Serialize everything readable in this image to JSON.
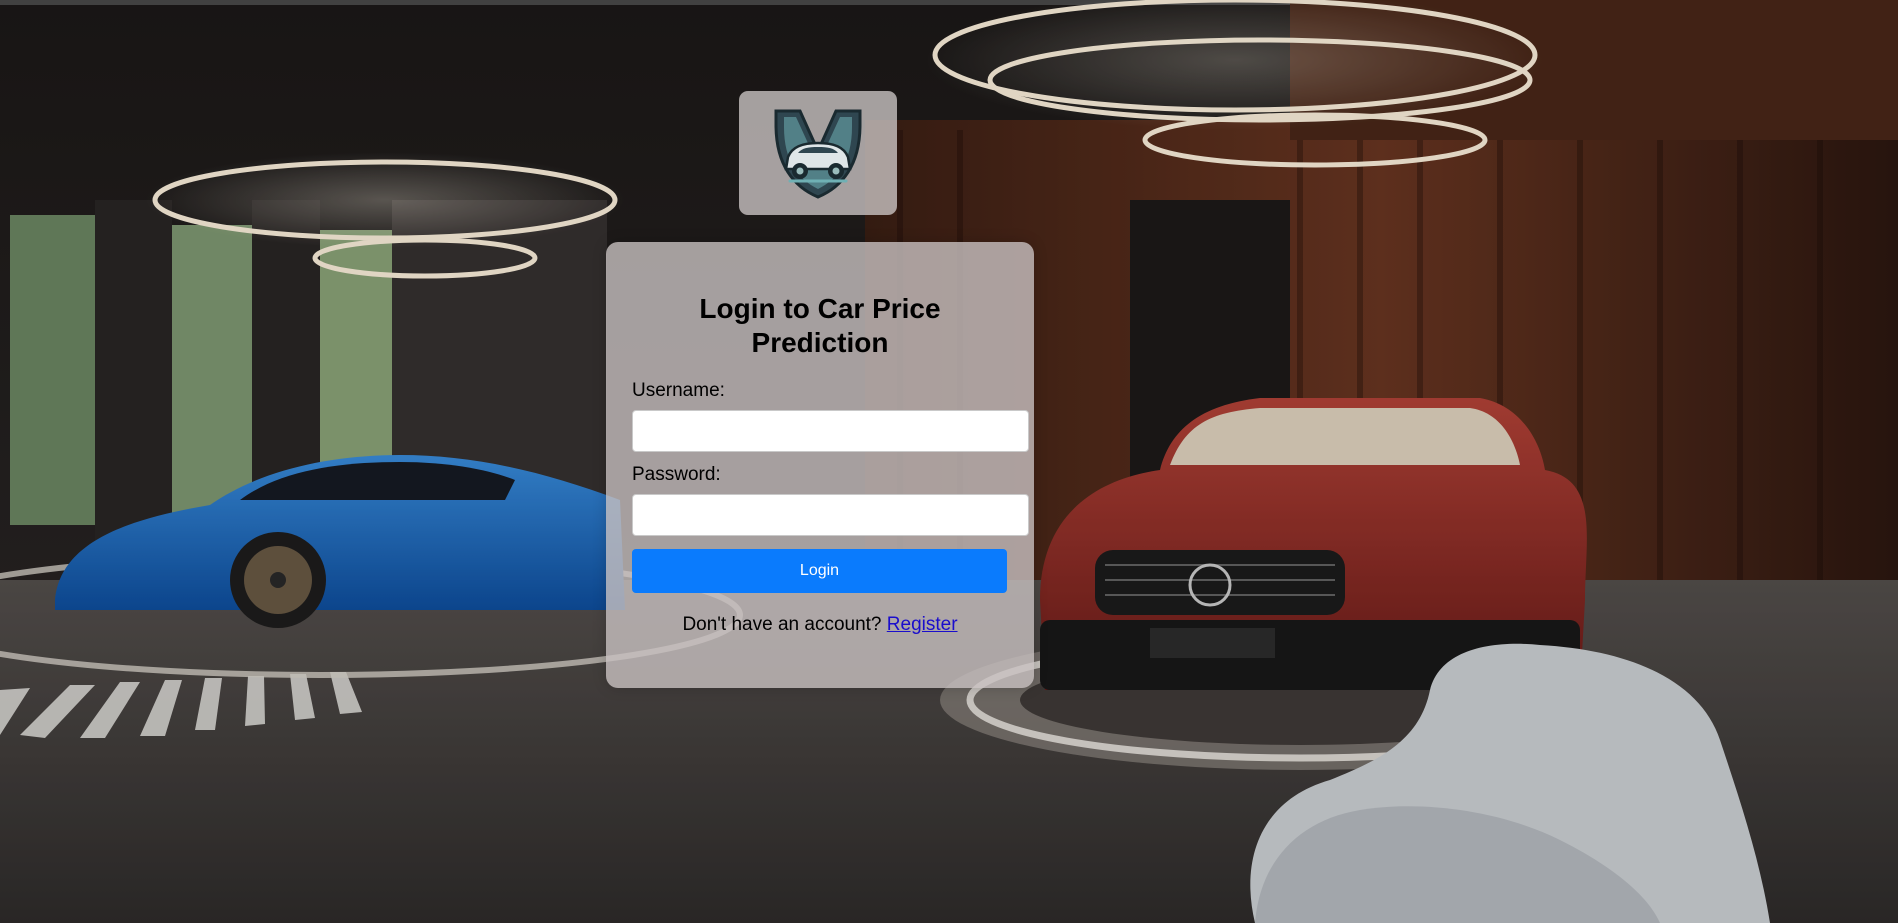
{
  "logo": {
    "icon": "car-shield-logo-icon"
  },
  "login_form": {
    "title": "Login to Car Price Prediction",
    "username_label": "Username:",
    "username_value": "",
    "password_label": "Password:",
    "password_value": "",
    "submit_label": "Login",
    "register_prompt": "Don't have an account?",
    "register_link": "Register"
  },
  "colors": {
    "button": "#0a7bfd",
    "link": "#1a0dcc",
    "card": "#c8c1c1"
  }
}
